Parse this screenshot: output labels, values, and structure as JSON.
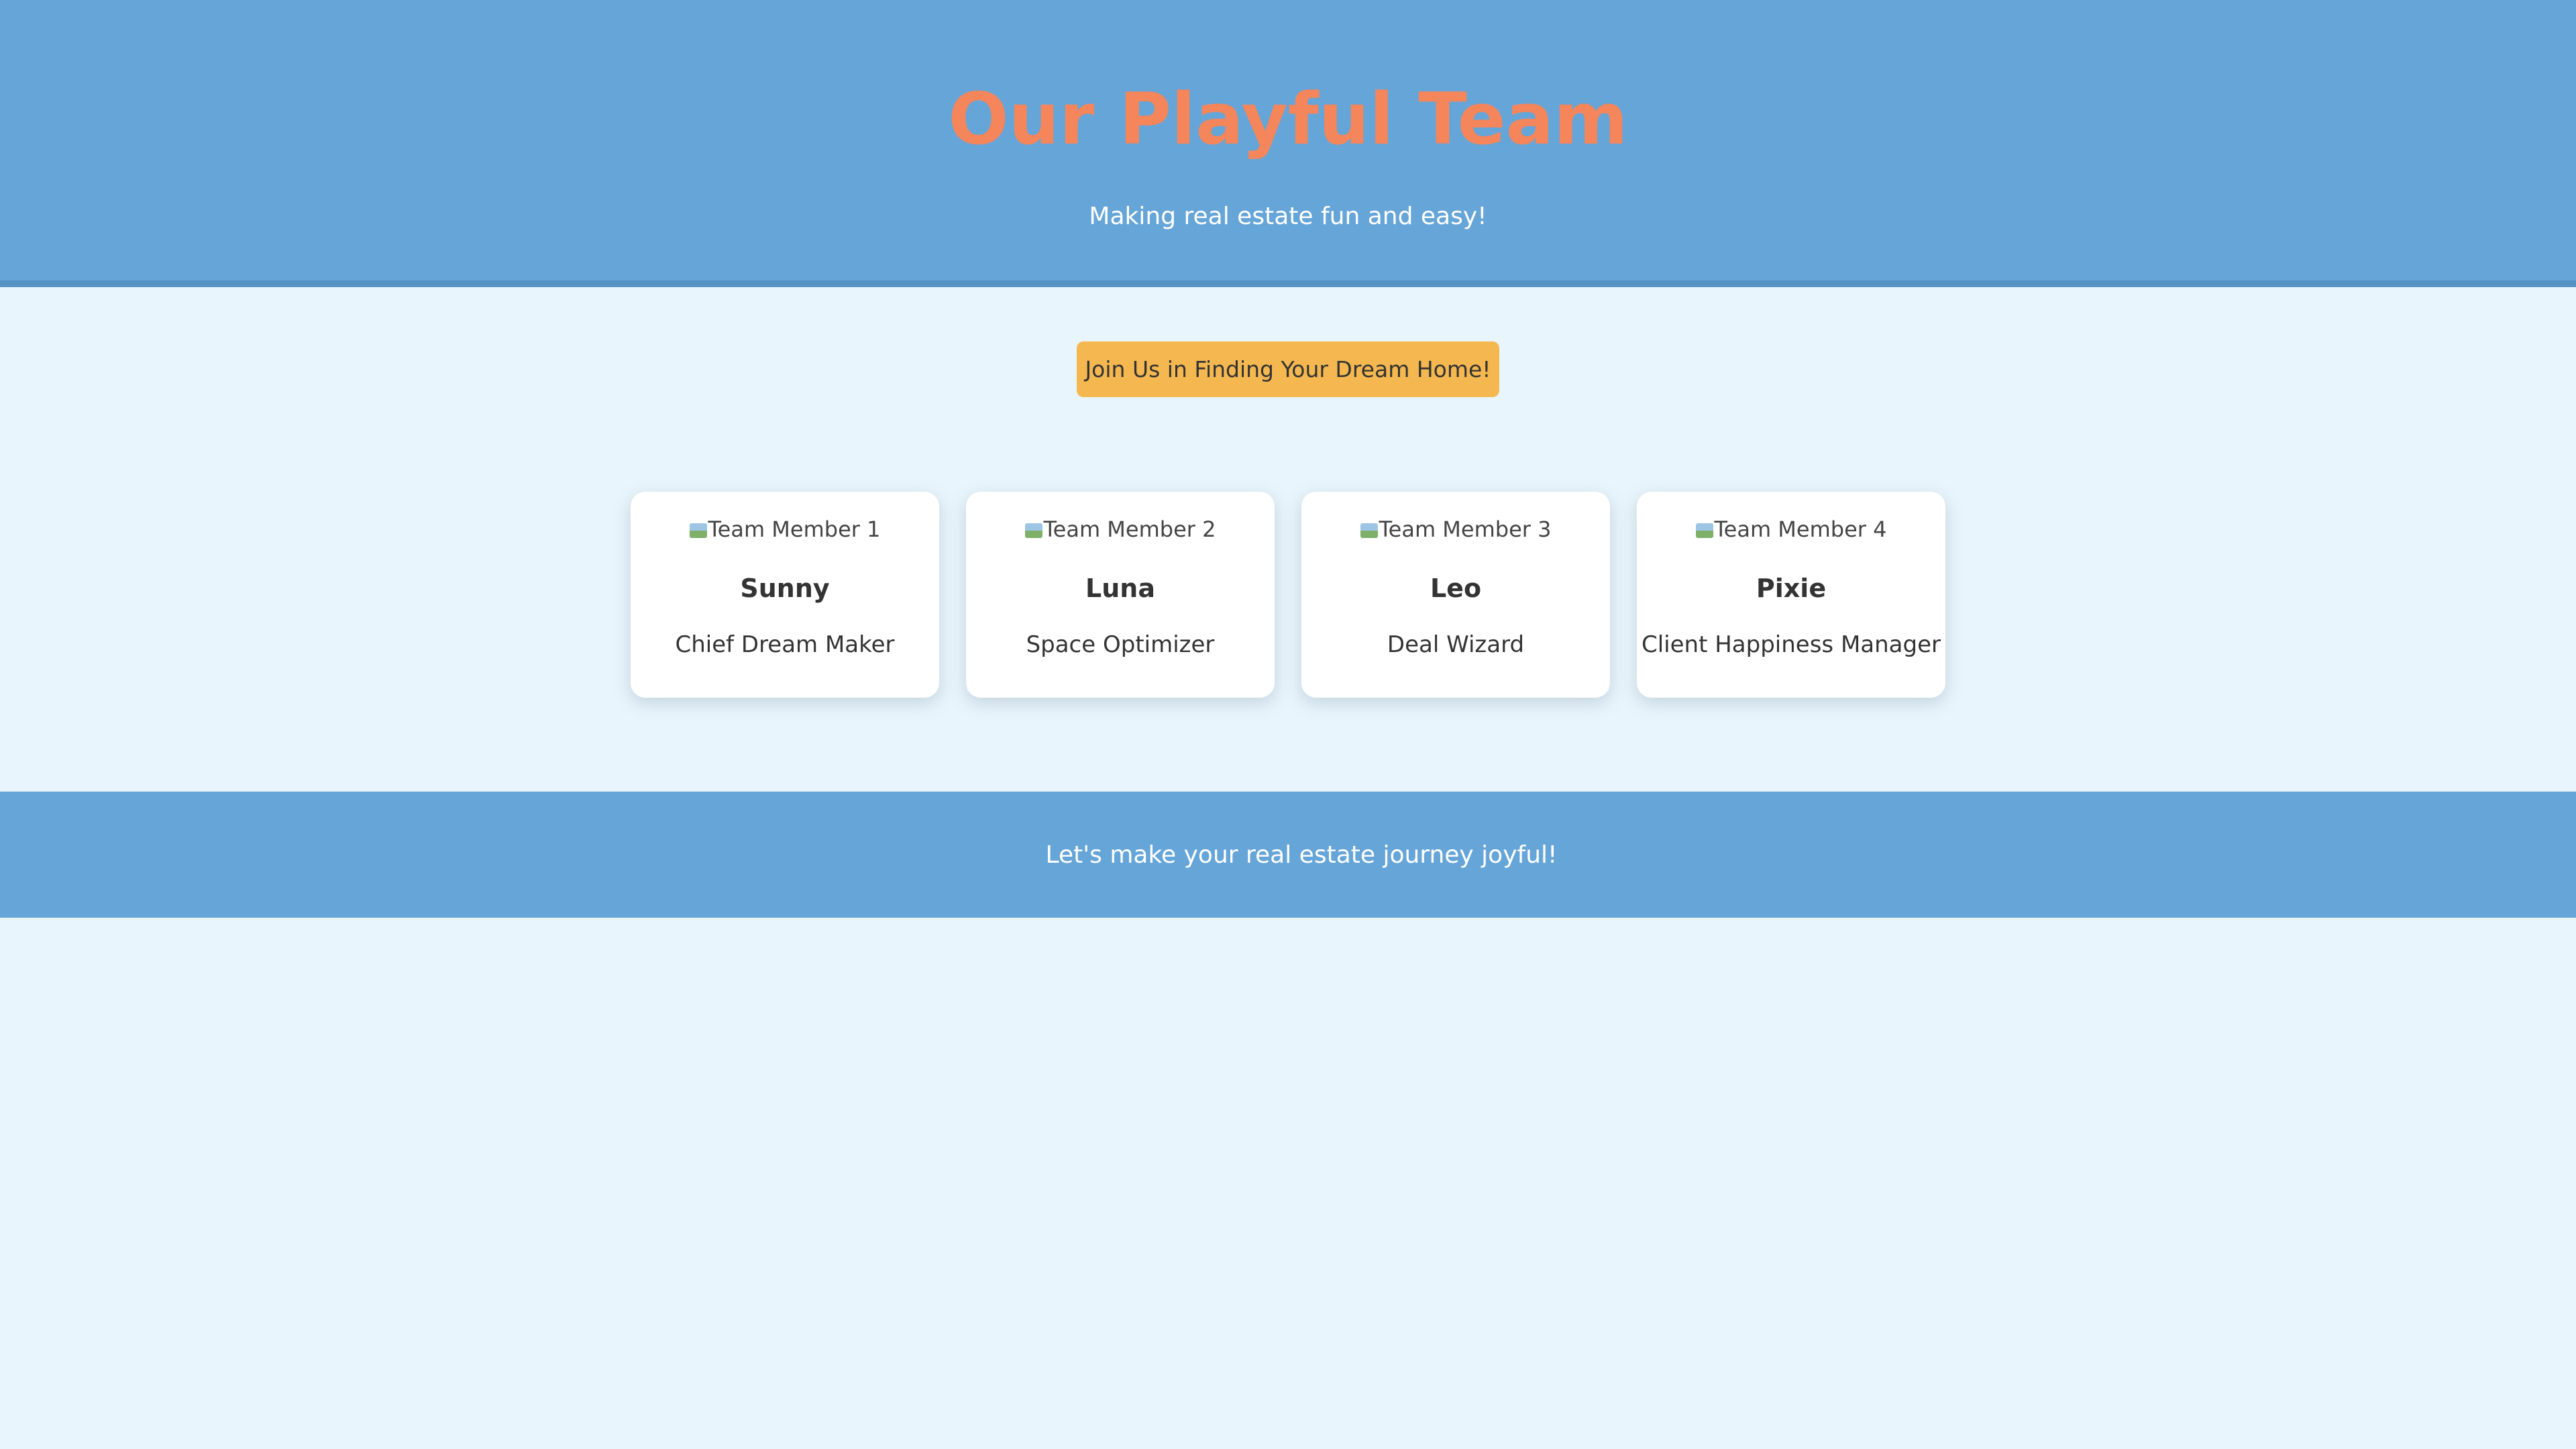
{
  "header": {
    "title": "Our Playful Team",
    "subtitle": "Making real estate fun and easy!"
  },
  "cta": {
    "label": "Join Us in Finding Your Dream Home!"
  },
  "team": [
    {
      "image_alt": "Team Member 1",
      "name": "Sunny",
      "role": "Chief Dream Maker"
    },
    {
      "image_alt": "Team Member 2",
      "name": "Luna",
      "role": "Space Optimizer"
    },
    {
      "image_alt": "Team Member 3",
      "name": "Leo",
      "role": "Deal Wizard"
    },
    {
      "image_alt": "Team Member 4",
      "name": "Pixie",
      "role": "Client Happiness Manager"
    }
  ],
  "footer": {
    "text": "Let's make your real estate journey joyful!"
  },
  "colors": {
    "header_bg": "#66a5d8",
    "title": "#f5855a",
    "page_bg": "#e9f5fc",
    "cta_bg": "#f5b850"
  }
}
